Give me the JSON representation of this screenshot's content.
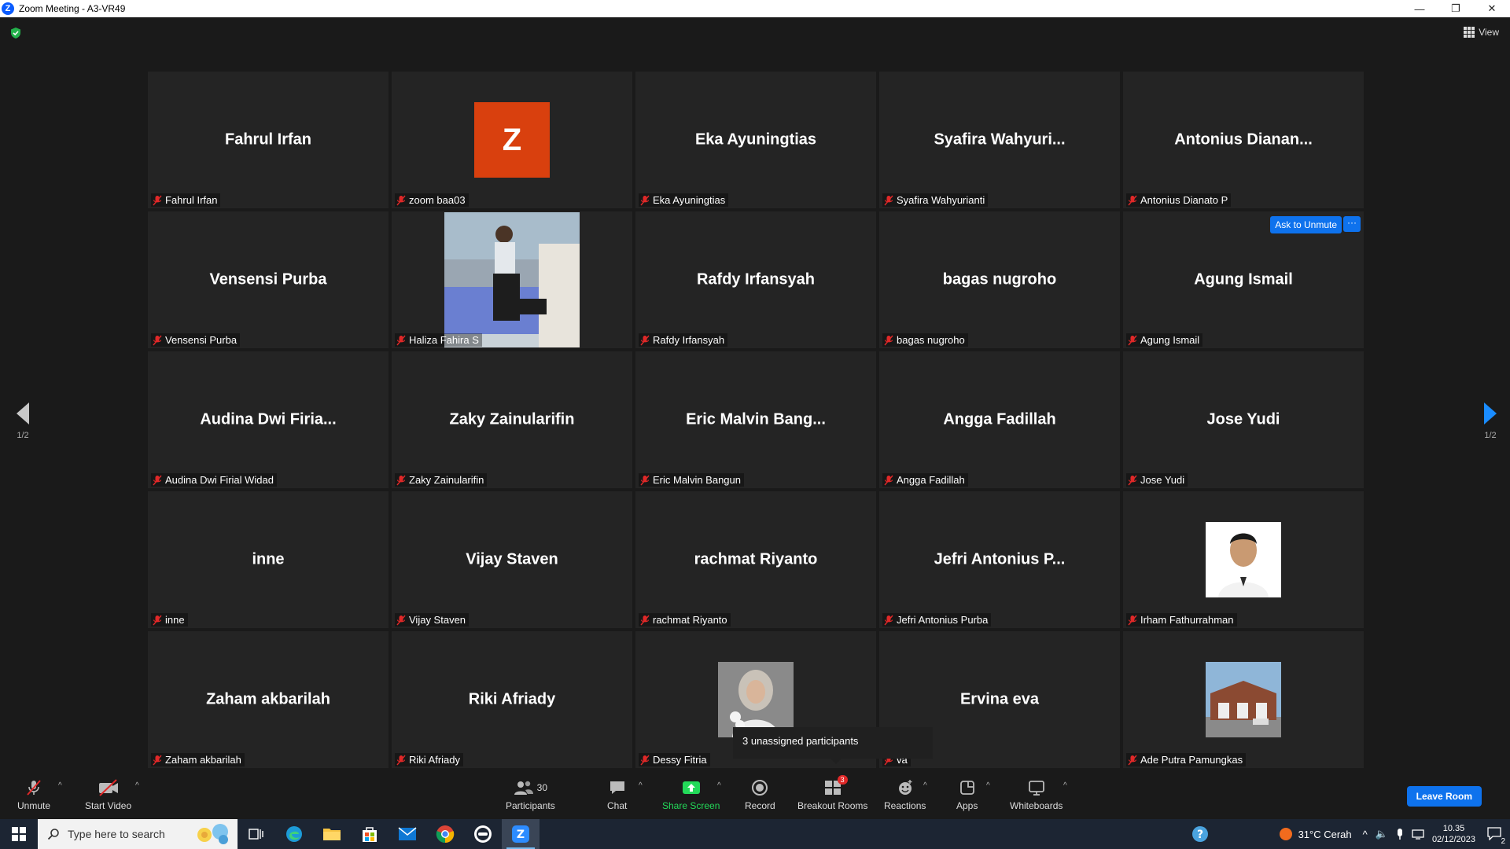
{
  "window": {
    "title": "Zoom Meeting - A3-VR49"
  },
  "view_label": "View",
  "pager": {
    "left": "1/2",
    "right": "1/2"
  },
  "ask_unmute_label": "Ask to Unmute",
  "more_label": "···",
  "tiles": [
    {
      "big": "Fahrul Irfan",
      "label": "Fahrul Irfan",
      "type": "name"
    },
    {
      "big": "Z",
      "label": "zoom baa03",
      "type": "avatar"
    },
    {
      "big": "Eka Ayuningtias",
      "label": "Eka Ayuningtias",
      "type": "name"
    },
    {
      "big": "Syafira  Wahyuri...",
      "label": "Syafira Wahyurianti",
      "type": "name"
    },
    {
      "big": "Antonius  Dianan...",
      "label": "Antonius Dianato P",
      "type": "name"
    },
    {
      "big": "Vensensi Purba",
      "label": "Vensensi Purba",
      "type": "name"
    },
    {
      "big": "",
      "label": "Haliza Fahira S",
      "type": "photo-person"
    },
    {
      "big": "Rafdy Irfansyah",
      "label": "Rafdy Irfansyah",
      "type": "name"
    },
    {
      "big": "bagas nugroho",
      "label": "bagas nugroho",
      "type": "name"
    },
    {
      "big": "Agung Ismail",
      "label": "Agung Ismail",
      "type": "name-ask"
    },
    {
      "big": "Audina  Dwi  Firia...",
      "label": "Audina Dwi Firial Widad",
      "type": "name"
    },
    {
      "big": "Zaky Zainularifin",
      "label": "Zaky Zainularifin",
      "type": "name"
    },
    {
      "big": "Eric  Malvin  Bang...",
      "label": "Eric Malvin Bangun",
      "type": "name"
    },
    {
      "big": "Angga Fadillah",
      "label": "Angga Fadillah",
      "type": "name"
    },
    {
      "big": "Jose Yudi",
      "label": "Jose Yudi",
      "type": "name"
    },
    {
      "big": "inne",
      "label": "inne",
      "type": "name"
    },
    {
      "big": "Vijay Staven",
      "label": "Vijay Staven",
      "type": "name"
    },
    {
      "big": "rachmat Riyanto",
      "label": "rachmat Riyanto",
      "type": "name"
    },
    {
      "big": "Jefri  Antonius  P...",
      "label": "Jefri Antonius Purba",
      "type": "name"
    },
    {
      "big": "",
      "label": "Irham Fathurrahman",
      "type": "photo-man"
    },
    {
      "big": "Zaham akbarilah",
      "label": "Zaham akbarilah",
      "type": "name"
    },
    {
      "big": "Riki Afriady",
      "label": "Riki Afriady",
      "type": "name"
    },
    {
      "big": "",
      "label": "Dessy Fitria",
      "type": "photo-woman"
    },
    {
      "big": "Ervina eva",
      "label": "va",
      "type": "name"
    },
    {
      "big": "",
      "label": "Ade Putra Pamungkas",
      "type": "photo-building"
    }
  ],
  "tooltip": "3 unassigned participants",
  "toolbar": {
    "unmute": "Unmute",
    "start_video": "Start Video",
    "participants": "Participants",
    "participants_count": "30",
    "chat": "Chat",
    "share_screen": "Share Screen",
    "record": "Record",
    "breakout_rooms": "Breakout Rooms",
    "breakout_badge": "3",
    "reactions": "Reactions",
    "apps": "Apps",
    "whiteboards": "Whiteboards",
    "leave": "Leave Room"
  },
  "taskbar": {
    "search_placeholder": "Type here to search",
    "weather": "31°C  Cerah",
    "time": "10.35",
    "date": "02/12/2023",
    "notif_count": "2"
  },
  "colors": {
    "accent": "#0e72ed",
    "share_green": "#23d959",
    "mic_red": "#e02828",
    "avatar_orange": "#d9400e"
  }
}
